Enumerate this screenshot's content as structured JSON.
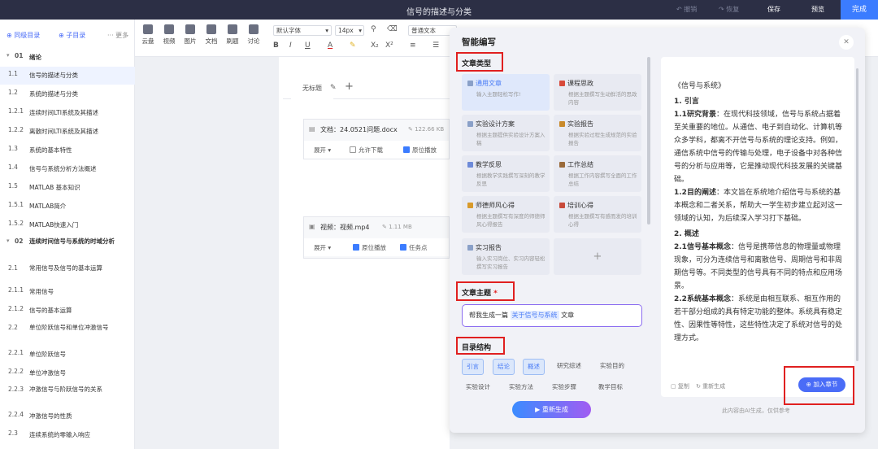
{
  "topbar": {
    "title": "信号的描述与分类",
    "undo": "撤销",
    "redo": "恢复",
    "save": "保存",
    "preview": "预览",
    "done": "完成"
  },
  "outline": {
    "add_same": "⊕ 同级目录",
    "add_child": "⊕ 子目录",
    "more": "··· 更多",
    "items": [
      {
        "num": "01",
        "label": "绪论",
        "chapter": true
      },
      {
        "num": "1.1",
        "label": "信号的描述与分类",
        "active": true
      },
      {
        "num": "1.2",
        "label": "系统的描述与分类"
      },
      {
        "num": "1.2.1",
        "label": "连续时间LTI系统及其描述"
      },
      {
        "num": "1.2.2",
        "label": "离散时间LTI系统及其描述"
      },
      {
        "num": "1.3",
        "label": "系统的基本特性"
      },
      {
        "num": "1.4",
        "label": "信号与系统分析方法概述"
      },
      {
        "num": "1.5",
        "label": "MATLAB 基本知识"
      },
      {
        "num": "1.5.1",
        "label": "MATLAB简介"
      },
      {
        "num": "1.5.2",
        "label": "MATLAB快速入门"
      },
      {
        "num": "02",
        "label": "连续时间信号与系统的时域分析",
        "chapter": true
      },
      {
        "num": "2.1",
        "label": "常用信号及信号的基本运算"
      },
      {
        "num": "2.1.1",
        "label": "常用信号"
      },
      {
        "num": "2.1.2",
        "label": "信号的基本运算"
      },
      {
        "num": "2.2",
        "label": "单位阶跃信号和单位冲激信号"
      },
      {
        "num": "2.2.1",
        "label": "单位阶跃信号"
      },
      {
        "num": "2.2.2",
        "label": "单位冲激信号"
      },
      {
        "num": "2.2.3",
        "label": "冲激信号与阶跃信号的关系"
      },
      {
        "num": "2.2.4",
        "label": "冲激信号的性质"
      },
      {
        "num": "2.3",
        "label": "连续系统的零输入响应"
      }
    ]
  },
  "toolbar": {
    "tools": [
      {
        "label": "云盘",
        "icon": "cloud-icon"
      },
      {
        "label": "视频",
        "icon": "video-icon"
      },
      {
        "label": "图片",
        "icon": "image-icon"
      },
      {
        "label": "文档",
        "icon": "document-icon"
      },
      {
        "label": "刷题",
        "icon": "quiz-icon"
      },
      {
        "label": "讨论",
        "icon": "discussion-icon"
      }
    ],
    "font": "默认字体",
    "size": "14px",
    "paragraph": "普通文本",
    "bold": "B",
    "italic": "I",
    "underline": "U",
    "font_color": "A",
    "subscript": "X₂",
    "superscript": "X²"
  },
  "editor": {
    "tab_label": "无标题",
    "doc_card": {
      "label": "文档：24.0521问题.docx",
      "size": "122.66 KB",
      "expand": "展开",
      "allow_download": "允许下载",
      "in_place": "原位播放"
    },
    "video_card": {
      "label": "视频：视频.mp4",
      "size": "1.11 MB",
      "expand": "展开",
      "in_place": "原位播放",
      "task_point": "任务点"
    }
  },
  "modal": {
    "title": "智能编写",
    "section_type": "文章类型",
    "types": [
      {
        "name": "通用文章",
        "desc": "输入主题轻松写作!",
        "selected": true,
        "color": "#8aa0c8"
      },
      {
        "name": "课程思政",
        "desc": "根据主题撰写生动鲜活的思政内容",
        "color": "#d84a3a"
      },
      {
        "name": "实验设计方案",
        "desc": "根据主题提供实验设计方案入稿",
        "color": "#8aa0c8"
      },
      {
        "name": "实验报告",
        "desc": "根据实验过程生成规范的实验报告",
        "color": "#c98a2a"
      },
      {
        "name": "教学反思",
        "desc": "根据教学实践撰写深刻的教学反思",
        "color": "#6d8ad8"
      },
      {
        "name": "工作总结",
        "desc": "根据工作内容撰写全面的工作总结",
        "color": "#9a6a3a"
      },
      {
        "name": "师德师风心得",
        "desc": "根据主题撰写有深度的师德师风心得报告",
        "color": "#d89a2a"
      },
      {
        "name": "培训心得",
        "desc": "根据主题撰写有感而发的培训心得",
        "color": "#c84a3a"
      },
      {
        "name": "实习报告",
        "desc": "输入实习岗位、实习内容轻松撰写实习报告",
        "color": "#8aa0c8"
      }
    ],
    "add_symbol": "+",
    "section_topic": "文章主题",
    "required_mark": "*",
    "topic_prefix": "帮我生成一篇",
    "topic_highlight": "关于信号与系统",
    "topic_suffix": "文章",
    "section_structure": "目录结构",
    "chips": [
      {
        "label": "引言",
        "on": true
      },
      {
        "label": "结论",
        "on": true
      },
      {
        "label": "概述",
        "on": true
      },
      {
        "label": "研究综述",
        "on": false
      },
      {
        "label": "实验目的",
        "on": false
      }
    ],
    "chips_row2": [
      "实验设计",
      "实验方法",
      "实验步骤",
      "教学目标"
    ],
    "regenerate": "▶ 重新生成",
    "preview": {
      "title": "《信号与系统》",
      "h1": "1. 引言",
      "p1_head": "1.1研究背景",
      "p1": "：在现代科技领域，信号与系统占据着至关重要的地位。从通信、电子到自动化、计算机等众多学科，都离不开信号与系统的理论支持。例如，通信系统中信号的传输与处理，电子设备中对各种信号的分析与应用等，它是推动现代科技发展的关键基础。",
      "p2_head": "1.2目的阐述",
      "p2": "：本文旨在系统地介绍信号与系统的基本概念和二者关系，帮助大一学生初步建立起对这一领域的认知，为后续深入学习打下基础。",
      "h2": "2. 概述",
      "p3_head": "2.1信号基本概念",
      "p3": "：信号是携带信息的物理量或物理现象，可分为连续信号和离散信号、周期信号和非周期信号等。不同类型的信号具有不同的特点和应用场景。",
      "p4_head": "2.2系统基本概念",
      "p4": "：系统是由相互联系、相互作用的若干部分组成的具有特定功能的整体。系统具有稳定性、因果性等特性，这些特性决定了系统对信号的处理方式。",
      "copy": "复制",
      "regen": "重新生成",
      "add_chapter": "⊕ 加入章节",
      "disclaimer": "此内容由AI生成，仅供参考"
    }
  }
}
